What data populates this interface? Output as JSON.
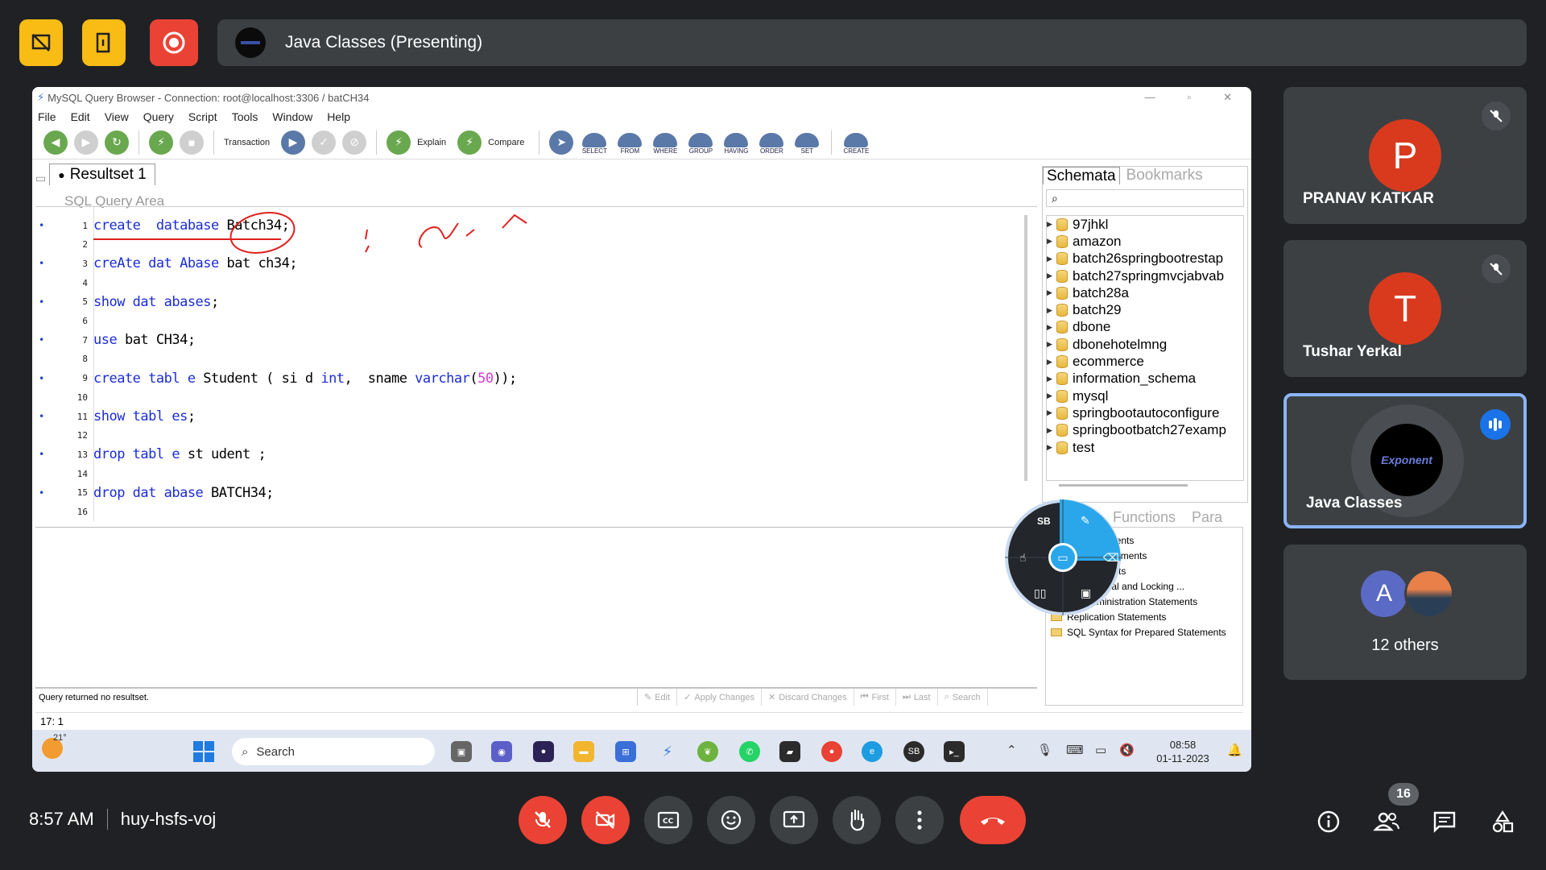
{
  "meeting": {
    "presenting_title": "Java Classes (Presenting)",
    "time": "8:57 AM",
    "code": "huy-hsfs-voj",
    "participant_count": "16"
  },
  "app": {
    "window_title": "MySQL Query Browser - Connection: root@localhost:3306 / batCH34",
    "menus": [
      "File",
      "Edit",
      "View",
      "Query",
      "Script",
      "Tools",
      "Window",
      "Help"
    ],
    "toolbar": {
      "transaction_label": "Transaction",
      "explain_label": "Explain",
      "compare_label": "Compare",
      "clauses": [
        "SELECT",
        "FROM",
        "WHERE",
        "GROUP",
        "HAVING",
        "ORDER",
        "SET"
      ],
      "create_label": "CREATE"
    },
    "result_tab": "Resultset 1",
    "sql_area_label": "SQL Query Area",
    "code_lines": [
      {
        "n": "1",
        "dot": true,
        "parts": [
          {
            "t": "create  database",
            "k": true
          },
          {
            "t": " Batch34;",
            "k": false
          }
        ]
      },
      {
        "n": "2",
        "dot": false,
        "parts": []
      },
      {
        "n": "3",
        "dot": true,
        "parts": [
          {
            "t": "creAte dat Abase",
            "k": true
          },
          {
            "t": " bat ch34;",
            "k": false
          }
        ]
      },
      {
        "n": "4",
        "dot": false,
        "parts": []
      },
      {
        "n": "5",
        "dot": true,
        "parts": [
          {
            "t": "show dat abases",
            "k": true
          },
          {
            "t": ";",
            "k": false
          }
        ]
      },
      {
        "n": "6",
        "dot": false,
        "parts": []
      },
      {
        "n": "7",
        "dot": true,
        "parts": [
          {
            "t": "use",
            "k": true
          },
          {
            "t": " bat CH34;",
            "k": false
          }
        ]
      },
      {
        "n": "8",
        "dot": false,
        "parts": []
      },
      {
        "n": "9",
        "dot": true,
        "parts": [
          {
            "t": "create tabl e",
            "k": true
          },
          {
            "t": " Student ( si d ",
            "k": false
          },
          {
            "t": "int",
            "k": true
          },
          {
            "t": ",  sname ",
            "k": false
          },
          {
            "t": "varchar",
            "k": true
          },
          {
            "t": "(",
            "k": false
          },
          {
            "t": "50",
            "k": false,
            "num": true
          },
          {
            "t": "));",
            "k": false
          }
        ]
      },
      {
        "n": "10",
        "dot": false,
        "parts": []
      },
      {
        "n": "11",
        "dot": true,
        "parts": [
          {
            "t": "show tabl es",
            "k": true
          },
          {
            "t": ";",
            "k": false
          }
        ]
      },
      {
        "n": "12",
        "dot": false,
        "parts": []
      },
      {
        "n": "13",
        "dot": true,
        "parts": [
          {
            "t": "drop tabl e",
            "k": true
          },
          {
            "t": " st udent ;",
            "k": false
          }
        ]
      },
      {
        "n": "14",
        "dot": false,
        "parts": []
      },
      {
        "n": "15",
        "dot": true,
        "parts": [
          {
            "t": "drop dat abase",
            "k": true
          },
          {
            "t": " BATCH34;",
            "k": false
          }
        ]
      },
      {
        "n": "16",
        "dot": false,
        "parts": []
      }
    ],
    "status_message": "Query returned no resultset.",
    "status_actions": [
      "Edit",
      "Apply Changes",
      "Discard Changes",
      "First",
      "Last",
      "Search"
    ],
    "cursor_position": "17: 1",
    "schemata_tab": "Schemata",
    "bookmarks_tab": "Bookmarks",
    "schemas": [
      "97jhkl",
      "amazon",
      "batch26springbootrestap",
      "batch27springmvcjabvab",
      "batch28a",
      "batch29",
      "dbone",
      "dbonehotelmng",
      "ecommerce",
      "information_schema",
      "mysql",
      "springbootautoconfigure",
      "springbootbatch27examp",
      "test"
    ],
    "functions_tab": "Functions",
    "params_tab": "Para",
    "function_items": [
      "tion Statements",
      "ulation Statements",
      "ty Statements",
      "ransactional and Locking ...",
      "ase Administration Statements",
      "Replication Statements",
      "SQL Syntax for Prepared Statements"
    ],
    "radial_sb": "SB"
  },
  "taskbar": {
    "weather_temp": "21°",
    "search_placeholder": "Search",
    "time": "08:58",
    "date": "01-11-2023"
  },
  "participants": [
    {
      "initial": "P",
      "name": "PRANAV KATKAR",
      "color": "#d93a1e"
    },
    {
      "initial": "T",
      "name": "Tushar Yerkal",
      "color": "#d93a1e"
    },
    {
      "name": "Java Classes"
    },
    {
      "initial": "A",
      "label": "12 others",
      "color": "#5b6ac4"
    }
  ],
  "logo_text": "Exponent"
}
